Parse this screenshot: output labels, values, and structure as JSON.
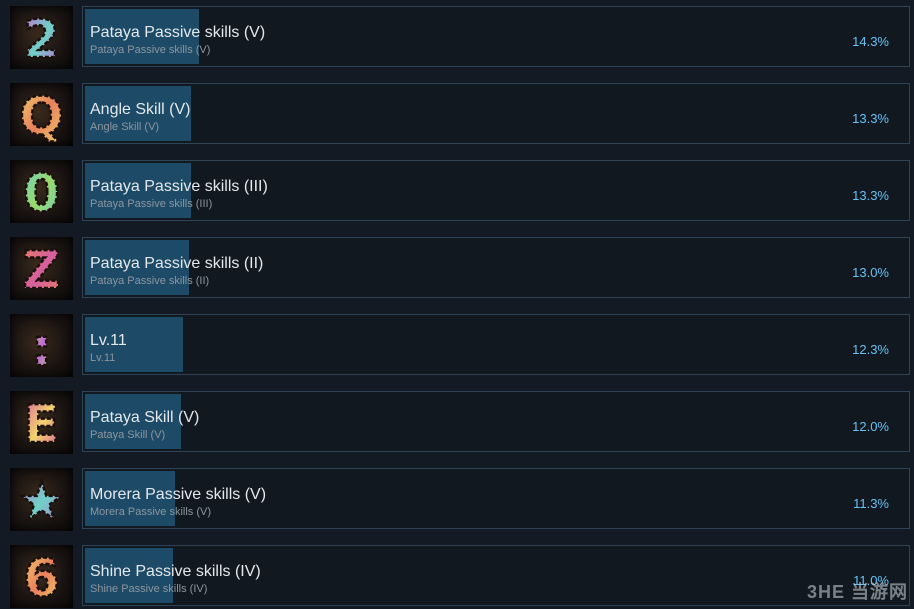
{
  "achievements": [
    {
      "glyph": "2",
      "title": "Pataya Passive skills (V)",
      "subtitle": "Pataya Passive skills (V)",
      "percent": "14.3%",
      "fraction": 0.143
    },
    {
      "glyph": "Q",
      "title": "Angle Skill (V)",
      "subtitle": "Angle Skill (V)",
      "percent": "13.3%",
      "fraction": 0.133
    },
    {
      "glyph": "0",
      "title": "Pataya Passive skills (III)",
      "subtitle": "Pataya Passive skills (III)",
      "percent": "13.3%",
      "fraction": 0.133
    },
    {
      "glyph": "Z",
      "title": "Pataya Passive skills (II)",
      "subtitle": "Pataya Passive skills (II)",
      "percent": "13.0%",
      "fraction": 0.13
    },
    {
      "glyph": ":",
      "title": "Lv.11",
      "subtitle": "Lv.11",
      "percent": "12.3%",
      "fraction": 0.123
    },
    {
      "glyph": "E",
      "title": "Pataya Skill (V)",
      "subtitle": "Pataya Skill (V)",
      "percent": "12.0%",
      "fraction": 0.12
    },
    {
      "glyph": "★",
      "title": "Morera Passive skills (V)",
      "subtitle": "Morera Passive skills (V)",
      "percent": "11.3%",
      "fraction": 0.113
    },
    {
      "glyph": "6",
      "title": "Shine Passive skills (IV)",
      "subtitle": "Shine Passive skills (IV)",
      "percent": "11.0%",
      "fraction": 0.11
    }
  ],
  "watermark": "3HE 当游网",
  "colors": {
    "background": "#131a24",
    "card": "#111820",
    "card_border": "#2e4355",
    "progress_fill": "#1d4a66",
    "percent_text": "#67c1f5"
  }
}
